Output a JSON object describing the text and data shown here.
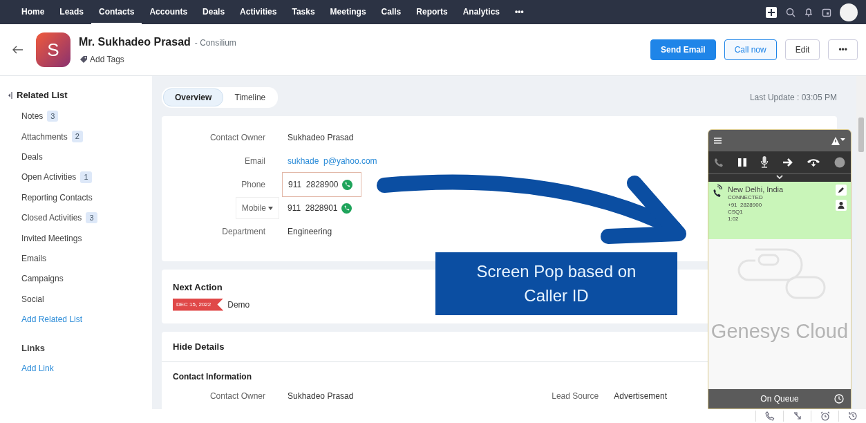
{
  "nav": {
    "items": [
      {
        "label": "Home",
        "selected": false
      },
      {
        "label": "Leads",
        "selected": false
      },
      {
        "label": "Contacts",
        "selected": true
      },
      {
        "label": "Accounts",
        "selected": false
      },
      {
        "label": "Deals",
        "selected": false
      },
      {
        "label": "Activities",
        "selected": false
      },
      {
        "label": "Tasks",
        "selected": false
      },
      {
        "label": "Meetings",
        "selected": false
      },
      {
        "label": "Calls",
        "selected": false
      },
      {
        "label": "Reports",
        "selected": false
      },
      {
        "label": "Analytics",
        "selected": false
      }
    ],
    "more": "•••"
  },
  "header": {
    "avatar_letter": "S",
    "name": "Mr. Sukhadeo Prasad",
    "company": "- Consilium",
    "add_tags": "Add Tags",
    "buttons": [
      {
        "label": "Send Email",
        "kind": "primary"
      },
      {
        "label": "Call now",
        "kind": "outline"
      },
      {
        "label": "Edit",
        "kind": "plain"
      },
      {
        "label": "•••",
        "kind": "plain"
      }
    ]
  },
  "sidebar": {
    "title": "Related List",
    "items": [
      {
        "label": "Notes",
        "count": "3"
      },
      {
        "label": "Attachments",
        "count": "2"
      },
      {
        "label": "Deals"
      },
      {
        "label": "Open Activities",
        "count": "1"
      },
      {
        "label": "Reporting Contacts"
      },
      {
        "label": "Closed Activities",
        "count": "3"
      },
      {
        "label": "Invited Meetings"
      },
      {
        "label": "Emails"
      },
      {
        "label": "Campaigns"
      },
      {
        "label": "Social"
      }
    ],
    "add_related": "Add Related List",
    "links_title": "Links",
    "add_link": "Add Link"
  },
  "tabs": [
    {
      "label": "Overview",
      "selected": true
    },
    {
      "label": "Timeline",
      "selected": false
    }
  ],
  "last_update": "Last Update : 03:05 PM",
  "overview": [
    {
      "label": "Contact Owner",
      "value": "Sukhadeo Prasad",
      "kind": "text"
    },
    {
      "label": "Email",
      "value": "sukhade  p@yahoo.com",
      "kind": "link"
    },
    {
      "label": "Phone",
      "value": "911  2828900",
      "kind": "phone",
      "highlighted": true
    },
    {
      "label": "Mobile",
      "value": "911  2828901",
      "kind": "phone",
      "highlighted": false,
      "label_dropdown": true
    },
    {
      "label": "Department",
      "value": "Engineering",
      "kind": "text"
    }
  ],
  "next_action": {
    "title": "Next Action",
    "date": "DEC 15, 2022",
    "subject": "Demo"
  },
  "details": {
    "title": "Hide Details",
    "section": "Contact Information",
    "fields": [
      {
        "label": "Contact Owner",
        "value": "Sukhadeo Prasad"
      },
      {
        "label": "Lead Source",
        "value": "Advertisement"
      }
    ]
  },
  "callout": "Screen Pop based on Caller ID",
  "softphone": {
    "location": "New Delhi, India",
    "status": "CONNECTED",
    "number": "+91  2828900",
    "queue": "CSQ1",
    "duration": "1:02",
    "watermark": "Genesys Cloud",
    "footer": "On Queue"
  }
}
